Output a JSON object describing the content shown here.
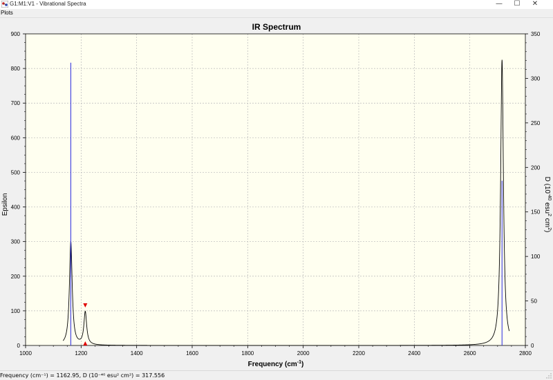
{
  "window": {
    "title": "G1:M1:V1 - Vibrational Spectra",
    "minimize": "—",
    "maximize": "☐",
    "close": "✕"
  },
  "menu": {
    "plots": "Plots"
  },
  "status": {
    "text": "Frequency (cm⁻¹) = 1162.95, D (10⁻⁴⁰ esu² cm²) = 317.556"
  },
  "icons": {
    "app": "app-icon",
    "grip": "resize-grip-icon"
  },
  "colors": {
    "plot_bg": "#fffff0",
    "curve": "#000000",
    "sticks": "#3a3ae0",
    "marker": "#e00000",
    "grid": "#b8b8b8"
  },
  "chart_data": {
    "type": "line",
    "title": "IR Spectrum",
    "xlabel": "Frequency (cm-1)",
    "ylabel_left": "Epsilon",
    "ylabel_right": "D (10-40 esu2 cm2)",
    "xlim": [
      1000,
      2800
    ],
    "ylim_left": [
      0,
      900
    ],
    "ylim_right": [
      0,
      350
    ],
    "x_ticks": [
      1000,
      1200,
      1400,
      1600,
      1800,
      2000,
      2200,
      2400,
      2600,
      2800
    ],
    "y_ticks_left": [
      0,
      100,
      200,
      300,
      400,
      500,
      600,
      700,
      800,
      900
    ],
    "y_ticks_right": [
      0,
      50,
      100,
      150,
      200,
      250,
      300,
      350
    ],
    "grid": true,
    "peaks": [
      {
        "freq": 1162.95,
        "epsilon": 300,
        "D": 317.556
      },
      {
        "freq": 1215,
        "epsilon": 95,
        "D": 0
      },
      {
        "freq": 2716,
        "epsilon": 825,
        "D": 185
      }
    ],
    "marker_freq": 1215
  }
}
